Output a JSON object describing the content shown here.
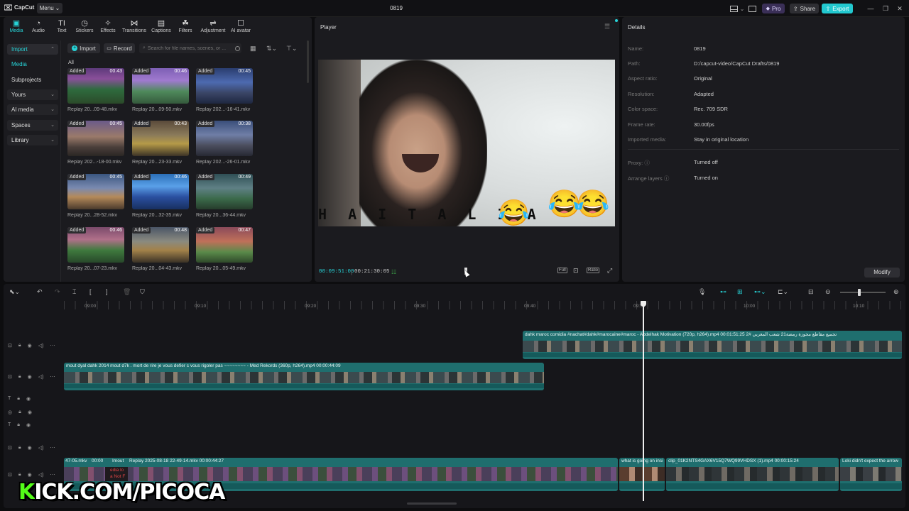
{
  "topbar": {
    "logo": "CapCut",
    "menu": "Menu",
    "title": "0819",
    "pro": "Pro",
    "share": "Share",
    "export": "Export"
  },
  "tabs": [
    {
      "label": "Media",
      "icon": "media-icon"
    },
    {
      "label": "Audio",
      "icon": "audio-icon"
    },
    {
      "label": "Text",
      "icon": "text-icon"
    },
    {
      "label": "Stickers",
      "icon": "stickers-icon"
    },
    {
      "label": "Effects",
      "icon": "effects-icon"
    },
    {
      "label": "Transitions",
      "icon": "transitions-icon"
    },
    {
      "label": "Captions",
      "icon": "captions-icon"
    },
    {
      "label": "Filters",
      "icon": "filters-icon"
    },
    {
      "label": "Adjustment",
      "icon": "adjustment-icon"
    },
    {
      "label": "AI avatar",
      "icon": "ai-avatar-icon"
    }
  ],
  "leftnav": {
    "import": "Import",
    "media": "Media",
    "subprojects": "Subprojects",
    "yours": "Yours",
    "ai_media": "AI media",
    "spaces": "Spaces",
    "library": "Library"
  },
  "media_toolbar": {
    "import": "Import",
    "record": "Record",
    "search_placeholder": "Search for file names, scenes, or ...",
    "all": "All"
  },
  "media_items": [
    {
      "added": "Added",
      "duration": "00:43",
      "name": "Replay 20...09-48.mkv"
    },
    {
      "added": "Added",
      "duration": "00:46",
      "name": "Replay 20...09-50.mkv"
    },
    {
      "added": "Added",
      "duration": "00:45",
      "name": "Replay 202...-16-41.mkv"
    },
    {
      "added": "Added",
      "duration": "00:45",
      "name": "Replay 202...-18-00.mkv"
    },
    {
      "added": "Added",
      "duration": "00:43",
      "name": "Replay 20...23-33.mkv"
    },
    {
      "added": "Added",
      "duration": "00:38",
      "name": "Replay 202...-26-01.mkv"
    },
    {
      "added": "Added",
      "duration": "00:45",
      "name": "Replay 20...28-52.mkv"
    },
    {
      "added": "Added",
      "duration": "00:46",
      "name": "Replay 20...32-35.mkv"
    },
    {
      "added": "Added",
      "duration": "00:49",
      "name": "Replay 20...36-44.mkv"
    },
    {
      "added": "Added",
      "duration": "00:46",
      "name": "Replay 20...07-23.mkv"
    },
    {
      "added": "Added",
      "duration": "00:48",
      "name": "Replay 20...04-43.mkv"
    },
    {
      "added": "Added",
      "duration": "00:47",
      "name": "Replay 20...05-49.mkv"
    }
  ],
  "player": {
    "title": "Player",
    "current_time": "00:09:51:00",
    "total_time": "00:21:30:05",
    "overlay_text": "H A   I T A L I A",
    "emoji": "😂",
    "full_label": "Full",
    "ratio_label": "Ratio"
  },
  "details": {
    "title": "Details",
    "rows": [
      {
        "label": "Name:",
        "value": "0819"
      },
      {
        "label": "Path:",
        "value": "D:/capcut-video/CapCut Drafts/0819"
      },
      {
        "label": "Aspect ratio:",
        "value": "Original"
      },
      {
        "label": "Resolution:",
        "value": "Adapted"
      },
      {
        "label": "Color space:",
        "value": "Rec. 709 SDR"
      },
      {
        "label": "Frame rate:",
        "value": "30.00fps"
      },
      {
        "label": "Imported media:",
        "value": "Stay in original location"
      },
      {
        "label": "Proxy:",
        "value": "Turned off"
      },
      {
        "label": "Arrange layers",
        "value": "Turned on"
      }
    ],
    "modify": "Modify"
  },
  "ruler": [
    "09:00",
    "09:10",
    "09:20",
    "09:30",
    "09:40",
    "09:50",
    "10:00",
    "10:10"
  ],
  "clips": {
    "c1": "dahk maroc comidia #nachat#dahk#marocaine#maroc - Abdelhak Motivation (720p, h264).mp4 تجميع مقاطع مجوزة رمضة21 شعب المغربي #2   00:01:51:25",
    "c2": "mout dyal dahk 2014 mout d7k . mort de rire je vous defier c vous rigoler pas ~~~~~~~~ - Med Rekords (360p, h264).mp4   00:00:44:09",
    "c3a": "47-05.mkv",
    "c3b": "00:00",
    "c3c": "Imout",
    "c3d": "Replay 2025-08-18 22-49-14.mkv   00:00:44:27",
    "c3e": "what is going on insi",
    "c3f": "clip_01K2NTS4GAX6V15Q7WQ99VHDSX (1).mp4   00:00:15:24",
    "c3g": "Loki didn't expect the arrow",
    "c3h": "edia lo",
    "c3i": "a Not F"
  },
  "watermark": {
    "k": "K",
    "rest": "ICK.COM/PICOCA"
  }
}
